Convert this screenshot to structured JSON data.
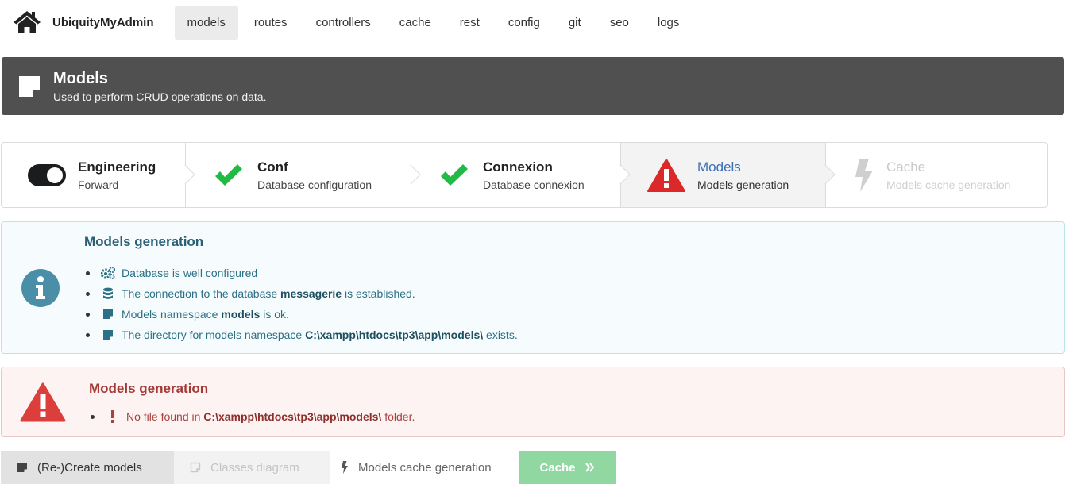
{
  "nav": {
    "brand": "UbiquityMyAdmin",
    "items": [
      {
        "label": "models",
        "active": true
      },
      {
        "label": "routes"
      },
      {
        "label": "controllers"
      },
      {
        "label": "cache"
      },
      {
        "label": "rest"
      },
      {
        "label": "config"
      },
      {
        "label": "git"
      },
      {
        "label": "seo"
      },
      {
        "label": "logs"
      }
    ]
  },
  "header": {
    "icon": "sticky-note-icon",
    "title": "Models",
    "subtitle": "Used to perform CRUD operations on data."
  },
  "steps": [
    {
      "icon": "toggle-on-icon",
      "title": "Engineering",
      "desc": "Forward",
      "state": "done"
    },
    {
      "icon": "check-icon",
      "title": "Conf",
      "desc": "Database configuration",
      "state": "done"
    },
    {
      "icon": "check-icon",
      "title": "Connexion",
      "desc": "Database connexion",
      "state": "done"
    },
    {
      "icon": "warning-icon",
      "title": "Models",
      "desc": "Models generation",
      "state": "active"
    },
    {
      "icon": "lightning-icon",
      "title": "Cache",
      "desc": "Models cache generation",
      "state": "disabled"
    }
  ],
  "info": {
    "icon": "info-circle-icon",
    "title": "Models generation",
    "items": {
      "db_configured": {
        "icon": "cogs-icon",
        "text": "Database is well configured"
      },
      "connection": {
        "icon": "database-icon",
        "before": "The connection to the database ",
        "bold": "messagerie",
        "after": " is established."
      },
      "namespace": {
        "icon": "sticky-note-icon",
        "before": "Models namespace ",
        "bold": "models",
        "after": " is ok."
      },
      "directory": {
        "icon": "sticky-note-icon",
        "before": "The directory for models namespace ",
        "bold": "C:\\xampp\\htdocs\\tp3\\app\\models\\",
        "after": " exists."
      }
    }
  },
  "error": {
    "icon": "warning-icon",
    "title": "Models generation",
    "item": {
      "icon": "exclamation-icon",
      "before": "No file found in ",
      "bold": "C:\\xampp\\htdocs\\tp3\\app\\models\\",
      "after": " folder."
    }
  },
  "buttons": {
    "create": "(Re-)Create models",
    "diagram": "Classes diagram",
    "cache_generation": "Models cache generation",
    "cache": "Cache"
  },
  "colors": {
    "success": "#21ba45",
    "danger": "#db2828",
    "info": "#4a8fa7",
    "banner": "#505050",
    "cache_button": "#90d7a1"
  }
}
